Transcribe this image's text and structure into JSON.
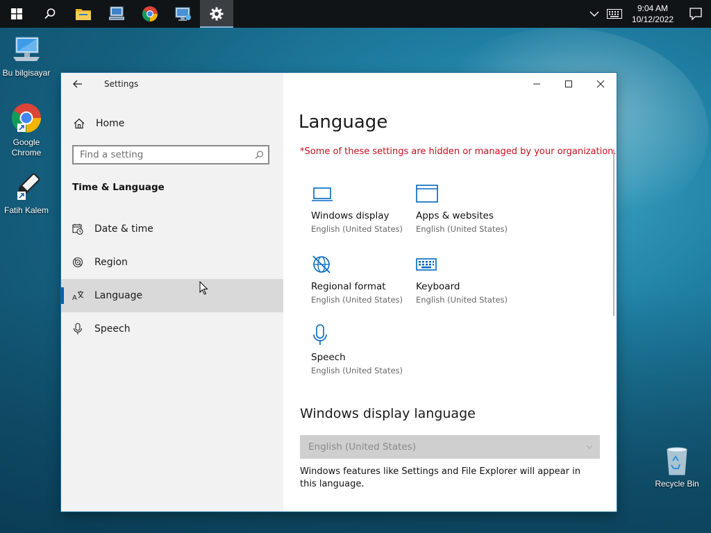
{
  "taskbar": {
    "clock_time": "9:04 AM",
    "clock_date": "10/12/2022"
  },
  "desktop": {
    "icons": [
      {
        "label": "Bu bilgisayar"
      },
      {
        "label": "Google Chrome"
      },
      {
        "label": "Fatih Kalem"
      },
      {
        "label": "Recycle Bin"
      }
    ]
  },
  "window": {
    "title": "Settings",
    "sidebar": {
      "home_label": "Home",
      "search_placeholder": "Find a setting",
      "section_title": "Time & Language",
      "items": [
        {
          "label": "Date & time",
          "icon": "calendar-clock-icon"
        },
        {
          "label": "Region",
          "icon": "region-globe-icon"
        },
        {
          "label": "Language",
          "icon": "language-icon",
          "selected": true
        },
        {
          "label": "Speech",
          "icon": "microphone-icon"
        }
      ]
    },
    "content": {
      "title": "Language",
      "managed_notice": "*Some of these settings are hidden or managed by your organization.",
      "tiles": [
        {
          "name": "Windows display",
          "sub": "English (United States)",
          "icon": "laptop-icon"
        },
        {
          "name": "Apps & websites",
          "sub": "English (United States)",
          "icon": "window-icon"
        },
        {
          "name": "Regional format",
          "sub": "English (United States)",
          "icon": "globe-icon"
        },
        {
          "name": "Keyboard",
          "sub": "English (United States)",
          "icon": "keyboard-icon"
        },
        {
          "name": "Speech",
          "sub": "English (United States)",
          "icon": "microphone-icon"
        }
      ],
      "display_language_heading": "Windows display language",
      "display_language_value": "English (United States)",
      "display_language_desc": "Windows features like Settings and File Explorer will appear in this language."
    }
  },
  "colors": {
    "accent": "#0063b1",
    "warning": "#c50f1f",
    "icon_blue": "#0067c0"
  }
}
